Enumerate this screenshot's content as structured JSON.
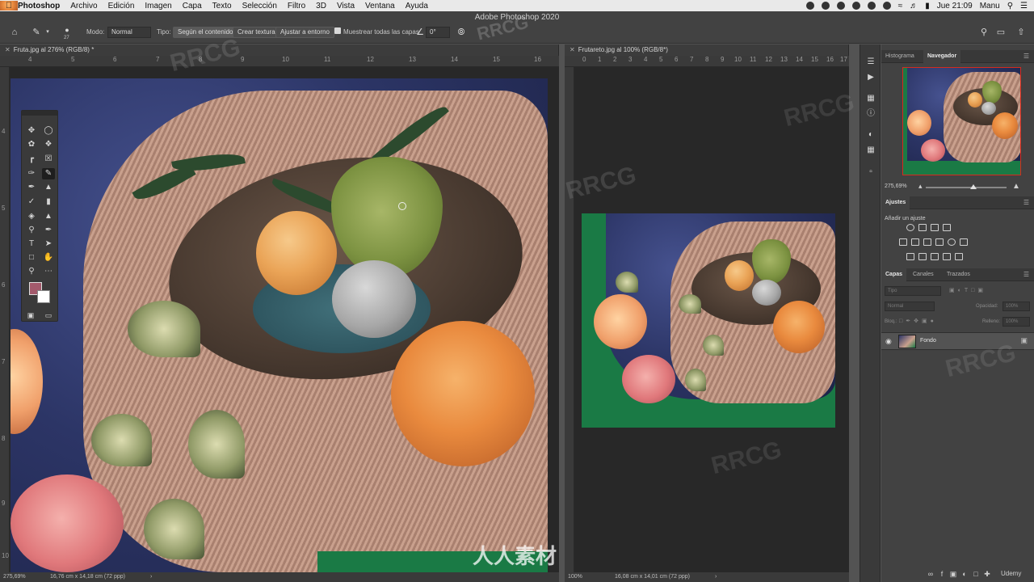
{
  "menubar": {
    "app": "Photoshop",
    "items": [
      "Archivo",
      "Edición",
      "Imagen",
      "Capa",
      "Texto",
      "Selección",
      "Filtro",
      "3D",
      "Vista",
      "Ventana",
      "Ayuda"
    ],
    "clock": "Jue 21:09",
    "user": "Manu"
  },
  "window_title": "Adobe Photoshop 2020",
  "options": {
    "brush_size": "27",
    "mode_label": "Modo:",
    "mode_value": "Normal",
    "type_label": "Tipo:",
    "type_options": [
      "Según el contenido",
      "Crear textura",
      "Ajustar a entorno"
    ],
    "sample_all_label": "Muestrear todas las capas",
    "angle_value": "0°"
  },
  "doc_left": {
    "tab": "Fruta.jpg al 276% (RGB/8) *",
    "ruler_h": [
      "4",
      "5",
      "6",
      "7",
      "8",
      "9",
      "10",
      "11",
      "12",
      "13",
      "14",
      "15",
      "16"
    ],
    "ruler_v": [
      "4",
      "5",
      "6",
      "7",
      "8",
      "9",
      "10"
    ],
    "zoom": "275,69%",
    "info": "16,76 cm x 14,18 cm (72 ppp)"
  },
  "doc_right": {
    "tab": "Frutareto.jpg al 100% (RGB/8*)",
    "ruler_h": [
      "0",
      "1",
      "2",
      "3",
      "4",
      "5",
      "6",
      "7",
      "8",
      "9",
      "10",
      "11",
      "12",
      "13",
      "14",
      "15",
      "16",
      "17"
    ],
    "zoom": "100%",
    "info": "16,08 cm x 14,01 cm (72 ppp)"
  },
  "panels": {
    "nav_tabs": [
      "Histograma",
      "Navegador"
    ],
    "nav_zoom": "275,69%",
    "adjust_title": "Ajustes",
    "adjust_hint": "Añadir un ajuste",
    "layer_tabs": [
      "Capas",
      "Canales",
      "Trazados"
    ],
    "layer_search": "Tipo",
    "blend_mode": "Normal",
    "opacity_label": "Opacidad:",
    "opacity_value": "100%",
    "lock_label": "Bloq.:",
    "fill_label": "Relleno:",
    "fill_value": "100%",
    "layer_name": "Fondo"
  },
  "watermarks": [
    "RRCG",
    "人人素材"
  ],
  "brand": "Udemy"
}
